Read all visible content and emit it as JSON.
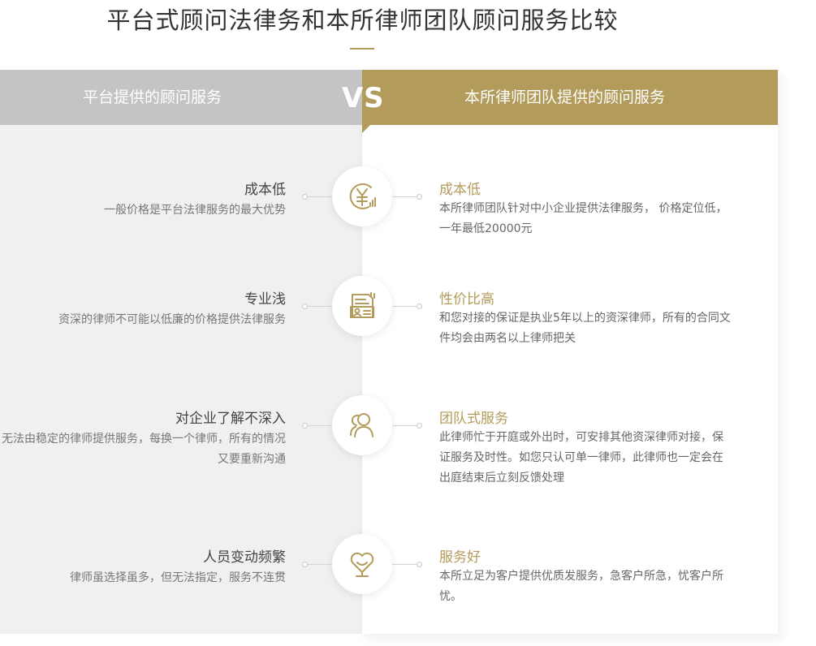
{
  "page": {
    "title": "平台式顾问法律务和本所律师团队顾问服务比较"
  },
  "header": {
    "left_label": "平台提供的顾问服务",
    "vs_v": "V",
    "vs_s": "S",
    "right_label": "本所律师团队提供的顾问服务"
  },
  "colors": {
    "accent": "#b39b5b",
    "left_header": "#c3c4c6",
    "left_panel": "#f0f0f0"
  },
  "rows": [
    {
      "icon": "yen-coin-icon",
      "left_title": "成本低",
      "left_desc": "一般价格是平台法律服务的最大优势",
      "right_title": "成本低",
      "right_desc": "本所律师团队针对中小企业提供法律服务， 价格定位低，一年最低20000元"
    },
    {
      "icon": "document-id-icon",
      "left_title": "专业浅",
      "left_desc": "资深的律师不可能以低廉的价格提供法律服务",
      "right_title": "性价比高",
      "right_desc": "和您对接的保证是执业5年以上的资深律师，所有的合同文件均会由两名以上律师把关"
    },
    {
      "icon": "team-people-icon",
      "left_title": "对企业了解不深入",
      "left_desc": "无法由稳定的律师提供服务，每换一个律师，所有的情况又要重新沟通",
      "right_title": "团队式服务",
      "right_desc": "此律师忙于开庭或外出时，可安排其他资深律师对接，保证服务及时性。如您只认可单一律师，此律师也一定会在出庭结束后立刻反馈处理"
    },
    {
      "icon": "heart-care-icon",
      "left_title": "人员变动频繁",
      "left_desc": "律师虽选择虽多，但无法指定，服务不连贯",
      "right_title": "服务好",
      "right_desc": "本所立足为客户提供优质发服务，急客户所急，忧客户所忧。"
    }
  ]
}
